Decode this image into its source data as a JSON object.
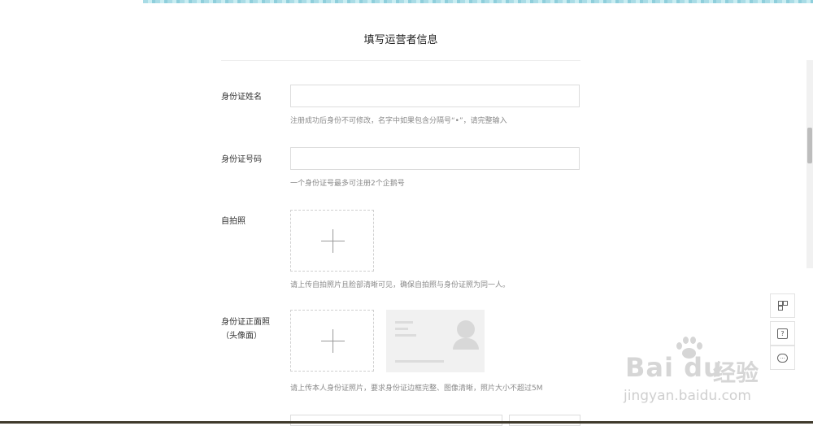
{
  "form": {
    "title": "填写运营者信息",
    "fields": [
      {
        "label": "身份证姓名",
        "value": "",
        "hint": "注册成功后身份不可修改，名字中如果包含分隔号“•”，请完整输入"
      },
      {
        "label": "身份证号码",
        "value": "",
        "hint": "一个身份证号最多可注册2个企鹅号"
      },
      {
        "label": "自拍照",
        "hint": "请上传自拍照片且脸部清晰可见，确保自拍照与身份证照为同一人。"
      },
      {
        "label_line1": "身份证正面照",
        "label_line2": "（头像面）",
        "hint": "请上传本人身份证照片，要求身份证边框完整、图像清晰，照片大小不超过5M"
      }
    ],
    "upload_icon": "plus-icon",
    "sample_icon": "id-card-sample-icon"
  },
  "sidebar": {
    "buttons": [
      {
        "name": "qrcode-icon"
      },
      {
        "name": "help-icon",
        "glyph": "?"
      },
      {
        "name": "chat-icon",
        "glyph": "…"
      }
    ]
  },
  "watermark": {
    "logo": "Bai du",
    "brand_cn": "经验",
    "url": "jingyan.baidu.com"
  }
}
